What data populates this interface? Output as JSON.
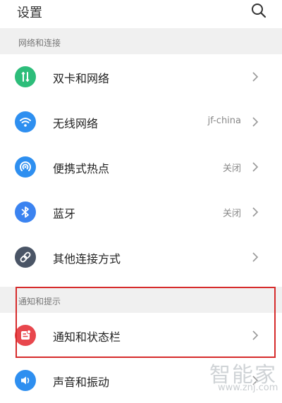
{
  "header": {
    "title": "设置",
    "search_icon": "search-icon"
  },
  "sections": [
    {
      "label": "网络和连接"
    },
    {
      "label": "通知和提示"
    }
  ],
  "rows": [
    {
      "label": "双卡和网络",
      "value": "",
      "icon": "dual-sim-icon",
      "color": "#2dbd7a"
    },
    {
      "label": "无线网络",
      "value": "jf-china",
      "icon": "wifi-icon",
      "color": "#2e8ff0"
    },
    {
      "label": "便携式热点",
      "value": "关闭",
      "icon": "hotspot-icon",
      "color": "#2e8ff0"
    },
    {
      "label": "蓝牙",
      "value": "关闭",
      "icon": "bluetooth-icon",
      "color": "#3b83f0"
    },
    {
      "label": "其他连接方式",
      "value": "",
      "icon": "link-icon",
      "color": "#4a5566"
    },
    {
      "label": "通知和状态栏",
      "value": "",
      "icon": "notification-icon",
      "color": "#e8474d"
    },
    {
      "label": "声音和振动",
      "value": "",
      "icon": "sound-icon",
      "color": "#2e8ff0"
    }
  ],
  "watermark": {
    "logo": "智能家",
    "url": "www.znj.com"
  }
}
